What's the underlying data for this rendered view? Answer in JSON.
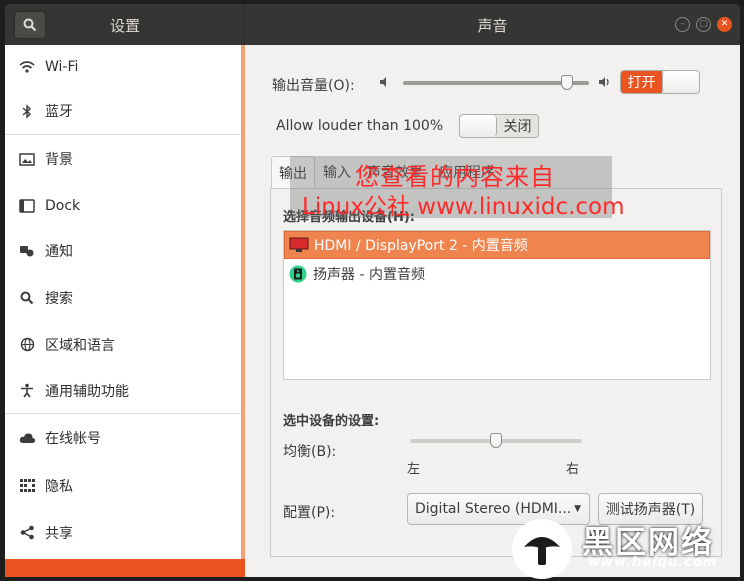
{
  "window": {
    "sidebar_title": "设置",
    "panel_title": "声音"
  },
  "sidebar": {
    "items": [
      {
        "label": "Wi-Fi",
        "icon": "wifi-icon"
      },
      {
        "label": "蓝牙",
        "icon": "bluetooth-icon"
      },
      {
        "label": "背景",
        "icon": "background-icon"
      },
      {
        "label": "Dock",
        "icon": "dock-icon"
      },
      {
        "label": "通知",
        "icon": "notification-icon"
      },
      {
        "label": "搜索",
        "icon": "search-icon"
      },
      {
        "label": "区域和语言",
        "icon": "globe-icon"
      },
      {
        "label": "通用辅助功能",
        "icon": "accessibility-icon"
      },
      {
        "label": "在线帐号",
        "icon": "cloud-icon"
      },
      {
        "label": "隐私",
        "icon": "privacy-icon"
      },
      {
        "label": "共享",
        "icon": "share-icon"
      }
    ]
  },
  "sound": {
    "output_volume_label": "输出音量(O):",
    "volume_level": 0.88,
    "volume_switch_label": "打开",
    "allow_louder_label": "Allow louder than 100%",
    "allow_louder_switch_label": "关闭",
    "tabs": [
      "输出",
      "输入",
      "声音效果",
      "应用程序"
    ],
    "active_tab": "输出",
    "select_device_label": "选择音频输出设备(H):",
    "devices": [
      {
        "label": "HDMI / DisplayPort 2 - 内置音频",
        "icon": "monitor-icon",
        "selected": true
      },
      {
        "label": "扬声器 - 内置音频",
        "icon": "speaker-icon",
        "selected": false
      }
    ],
    "device_settings_label": "选中设备的设置:",
    "balance_label": "均衡(B):",
    "balance_level": 0.5,
    "balance_left": "左",
    "balance_right": "右",
    "profile_label": "配置(P):",
    "profile_value": "Digital Stereo (HDMI...",
    "test_button": "测试扬声器(T)"
  },
  "watermark": {
    "line1": "您查看的内容来自",
    "line2": "Linux公社 www.linuxidc.com"
  },
  "logo": {
    "text": "黑区网络",
    "url": "www.heiqu.com"
  },
  "colors": {
    "accent": "#e95420",
    "header": "#353533",
    "selected_row": "#f0844f"
  }
}
